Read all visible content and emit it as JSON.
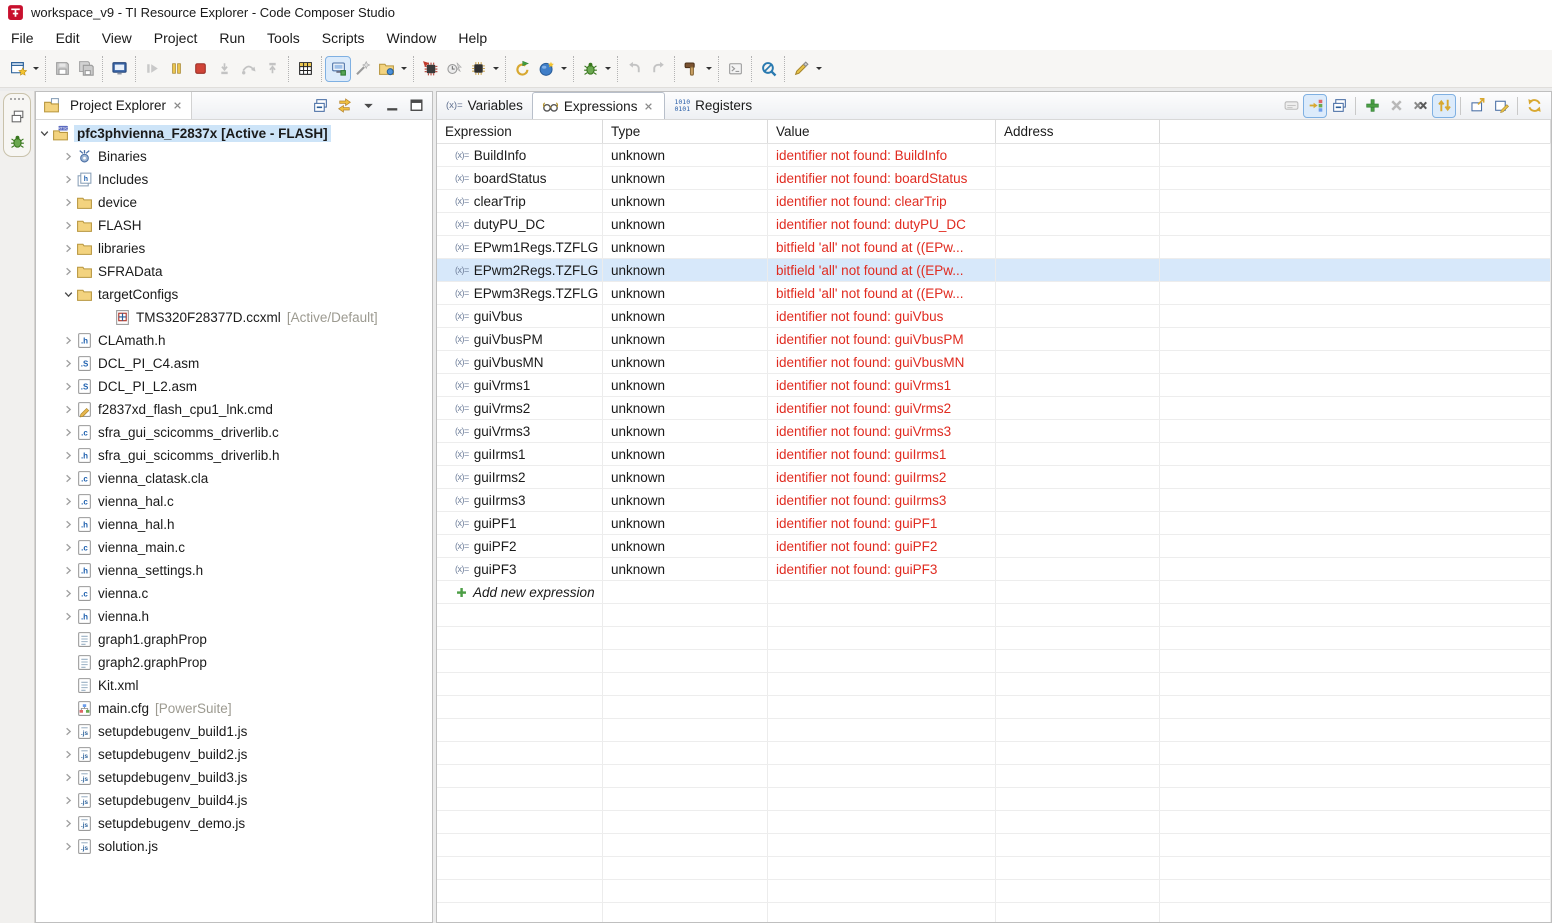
{
  "window": {
    "title": "workspace_v9 - TI Resource Explorer - Code Composer Studio"
  },
  "menu": {
    "items": [
      "File",
      "Edit",
      "View",
      "Project",
      "Run",
      "Tools",
      "Scripts",
      "Window",
      "Help"
    ]
  },
  "toolbar": {
    "groups": [
      {
        "items": [
          {
            "name": "new-wizard",
            "icon": "newwin",
            "dropdown": true
          }
        ]
      },
      {
        "items": [
          {
            "name": "save",
            "icon": "save"
          },
          {
            "name": "save-all",
            "icon": "saveall"
          }
        ]
      },
      {
        "items": [
          {
            "name": "debug-console",
            "icon": "consoleb"
          }
        ]
      },
      {
        "items": [
          {
            "name": "resume",
            "icon": "resume"
          },
          {
            "name": "suspend",
            "icon": "pause"
          },
          {
            "name": "terminate",
            "icon": "stop"
          },
          {
            "name": "step-into",
            "icon": "step1"
          },
          {
            "name": "step-over",
            "icon": "step2"
          },
          {
            "name": "step-return",
            "icon": "step3"
          }
        ]
      },
      {
        "items": [
          {
            "name": "view-registers",
            "icon": "grid"
          }
        ]
      },
      {
        "items": [
          {
            "name": "connect-target",
            "icon": "connect",
            "selected": true
          },
          {
            "name": "auto-connect",
            "icon": "wand"
          },
          {
            "name": "debug-project",
            "icon": "folderbug",
            "dropdown": true
          }
        ]
      },
      {
        "items": [
          {
            "name": "load-program",
            "icon": "loadchip"
          },
          {
            "name": "verify-flash",
            "icon": "flash"
          },
          {
            "name": "on-chip-flash",
            "icon": "chipdd",
            "dropdown": true
          }
        ]
      },
      {
        "items": [
          {
            "name": "restart",
            "icon": "restart"
          },
          {
            "name": "resource-explorer",
            "icon": "ball",
            "dropdown": true
          }
        ]
      },
      {
        "items": [
          {
            "name": "debug",
            "icon": "bug",
            "dropdown": true
          }
        ]
      },
      {
        "items": [
          {
            "name": "step-back",
            "icon": "hookl"
          },
          {
            "name": "step-forward",
            "icon": "hookr"
          }
        ]
      },
      {
        "items": [
          {
            "name": "build",
            "icon": "hammer",
            "dropdown": true
          }
        ]
      },
      {
        "items": [
          {
            "name": "open-console",
            "icon": "consolegray"
          }
        ]
      },
      {
        "items": [
          {
            "name": "search",
            "icon": "magnifier"
          }
        ]
      },
      {
        "items": [
          {
            "name": "flash-tool",
            "icon": "pen",
            "dropdown": true
          }
        ]
      }
    ]
  },
  "project_explorer": {
    "tab_label": "Project Explorer",
    "view_buttons": [
      {
        "name": "collapse-all",
        "icon": "collapseall"
      },
      {
        "name": "link-with-editor",
        "icon": "linked"
      },
      {
        "name": "view-menu",
        "icon": "vmenu"
      },
      {
        "name": "minimize",
        "icon": "vmin"
      },
      {
        "name": "maximize",
        "icon": "vmax"
      }
    ],
    "root": {
      "label": "pfc3phvienna_F2837x",
      "suffix": "[Active - FLASH]"
    },
    "items": [
      {
        "label": "Binaries",
        "icon": "bin",
        "chev": "collapsed",
        "level": 1
      },
      {
        "label": "Includes",
        "icon": "inc",
        "chev": "collapsed",
        "level": 1
      },
      {
        "label": "device",
        "icon": "folder",
        "chev": "collapsed",
        "level": 1
      },
      {
        "label": "FLASH",
        "icon": "folder",
        "chev": "collapsed",
        "level": 1
      },
      {
        "label": "libraries",
        "icon": "folder",
        "chev": "collapsed",
        "level": 1
      },
      {
        "label": "SFRAData",
        "icon": "folder",
        "chev": "collapsed",
        "level": 1
      },
      {
        "label": "targetConfigs",
        "icon": "folder",
        "chev": "expanded",
        "level": 1
      },
      {
        "label": "TMS320F28377D.ccxml",
        "suffix": "[Active/Default]",
        "icon": "ccxml",
        "chev": "none",
        "level": 2
      },
      {
        "label": "CLAmath.h",
        "icon": "h",
        "chev": "collapsed",
        "level": 1
      },
      {
        "label": "DCL_PI_C4.asm",
        "icon": "s",
        "chev": "collapsed",
        "level": 1
      },
      {
        "label": "DCL_PI_L2.asm",
        "icon": "s",
        "chev": "collapsed",
        "level": 1
      },
      {
        "label": "f2837xd_flash_cpu1_lnk.cmd",
        "icon": "cmd",
        "chev": "collapsed",
        "level": 1
      },
      {
        "label": "sfra_gui_scicomms_driverlib.c",
        "icon": "c",
        "chev": "collapsed",
        "level": 1
      },
      {
        "label": "sfra_gui_scicomms_driverlib.h",
        "icon": "h",
        "chev": "collapsed",
        "level": 1
      },
      {
        "label": "vienna_clatask.cla",
        "icon": "c",
        "chev": "collapsed",
        "level": 1
      },
      {
        "label": "vienna_hal.c",
        "icon": "c",
        "chev": "collapsed",
        "level": 1
      },
      {
        "label": "vienna_hal.h",
        "icon": "h",
        "chev": "collapsed",
        "level": 1
      },
      {
        "label": "vienna_main.c",
        "icon": "c",
        "chev": "collapsed",
        "level": 1
      },
      {
        "label": "vienna_settings.h",
        "icon": "h",
        "chev": "collapsed",
        "level": 1
      },
      {
        "label": "vienna.c",
        "icon": "c",
        "chev": "collapsed",
        "level": 1
      },
      {
        "label": "vienna.h",
        "icon": "h",
        "chev": "collapsed",
        "level": 1
      },
      {
        "label": "graph1.graphProp",
        "icon": "txt",
        "chev": "none",
        "level": 1
      },
      {
        "label": "graph2.graphProp",
        "icon": "txt",
        "chev": "none",
        "level": 1
      },
      {
        "label": "Kit.xml",
        "icon": "txt",
        "chev": "none",
        "level": 1
      },
      {
        "label": "main.cfg",
        "suffix": "[PowerSuite]",
        "icon": "cfg",
        "chev": "none",
        "level": 1
      },
      {
        "label": "setupdebugenv_build1.js",
        "icon": "js",
        "chev": "collapsed",
        "level": 1
      },
      {
        "label": "setupdebugenv_build2.js",
        "icon": "js",
        "chev": "collapsed",
        "level": 1
      },
      {
        "label": "setupdebugenv_build3.js",
        "icon": "js",
        "chev": "collapsed",
        "level": 1
      },
      {
        "label": "setupdebugenv_build4.js",
        "icon": "js",
        "chev": "collapsed",
        "level": 1
      },
      {
        "label": "setupdebugenv_demo.js",
        "icon": "js",
        "chev": "collapsed",
        "level": 1
      },
      {
        "label": "solution.js",
        "icon": "js",
        "chev": "collapsed",
        "level": 1
      }
    ]
  },
  "debug_view": {
    "tabs": [
      {
        "label": "Variables",
        "icon": "varicon",
        "active": false
      },
      {
        "label": "Expressions",
        "icon": "glasses",
        "active": true
      },
      {
        "label": "Registers",
        "icon": "regicon",
        "active": false
      }
    ],
    "view_buttons": [
      {
        "name": "show-type-names",
        "icon": "typenames"
      },
      {
        "name": "show-logical-structure",
        "icon": "logical",
        "selected": true
      },
      {
        "name": "collapse-all",
        "icon": "collapseall"
      },
      {
        "sep": true
      },
      {
        "name": "add-expression",
        "icon": "addplus"
      },
      {
        "name": "remove-expression",
        "icon": "grayx"
      },
      {
        "name": "remove-all-expressions",
        "icon": "darkxx"
      },
      {
        "name": "auto-refresh",
        "icon": "refreshud",
        "selected": true
      },
      {
        "sep": true
      },
      {
        "name": "detach-window",
        "icon": "detach"
      },
      {
        "name": "edit-watch-expression",
        "icon": "editv"
      },
      {
        "sep": true
      },
      {
        "name": "refresh",
        "icon": "refresh"
      }
    ],
    "columns": [
      "Expression",
      "Type",
      "Value",
      "Address"
    ],
    "selected_index": 5,
    "add_row_label": "Add new expression",
    "rows": [
      {
        "expression": "BuildInfo",
        "type": "unknown",
        "value": "identifier not found: BuildInfo",
        "address": ""
      },
      {
        "expression": "boardStatus",
        "type": "unknown",
        "value": "identifier not found: boardStatus",
        "address": ""
      },
      {
        "expression": "clearTrip",
        "type": "unknown",
        "value": "identifier not found: clearTrip",
        "address": ""
      },
      {
        "expression": "dutyPU_DC",
        "type": "unknown",
        "value": "identifier not found: dutyPU_DC",
        "address": ""
      },
      {
        "expression": "EPwm1Regs.TZFLG",
        "type": "unknown",
        "value": "bitfield 'all' not found at ((EPw...",
        "address": ""
      },
      {
        "expression": "EPwm2Regs.TZFLG",
        "type": "unknown",
        "value": "bitfield 'all' not found at ((EPw...",
        "address": ""
      },
      {
        "expression": "EPwm3Regs.TZFLG",
        "type": "unknown",
        "value": "bitfield 'all' not found at ((EPw...",
        "address": ""
      },
      {
        "expression": "guiVbus",
        "type": "unknown",
        "value": "identifier not found: guiVbus",
        "address": ""
      },
      {
        "expression": "guiVbusPM",
        "type": "unknown",
        "value": "identifier not found: guiVbusPM",
        "address": ""
      },
      {
        "expression": "guiVbusMN",
        "type": "unknown",
        "value": "identifier not found: guiVbusMN",
        "address": ""
      },
      {
        "expression": "guiVrms1",
        "type": "unknown",
        "value": "identifier not found: guiVrms1",
        "address": ""
      },
      {
        "expression": "guiVrms2",
        "type": "unknown",
        "value": "identifier not found: guiVrms2",
        "address": ""
      },
      {
        "expression": "guiVrms3",
        "type": "unknown",
        "value": "identifier not found: guiVrms3",
        "address": ""
      },
      {
        "expression": "guiIrms1",
        "type": "unknown",
        "value": "identifier not found: guiIrms1",
        "address": ""
      },
      {
        "expression": "guiIrms2",
        "type": "unknown",
        "value": "identifier not found: guiIrms2",
        "address": ""
      },
      {
        "expression": "guiIrms3",
        "type": "unknown",
        "value": "identifier not found: guiIrms3",
        "address": ""
      },
      {
        "expression": "guiPF1",
        "type": "unknown",
        "value": "identifier not found: guiPF1",
        "address": ""
      },
      {
        "expression": "guiPF2",
        "type": "unknown",
        "value": "identifier not found: guiPF2",
        "address": ""
      },
      {
        "expression": "guiPF3",
        "type": "unknown",
        "value": "identifier not found: guiPF3",
        "address": ""
      }
    ]
  },
  "colors": {
    "error_text": "#e02b20",
    "row_selection": "#d7e8fa",
    "tree_selection": "#cde4f8",
    "logo_red": "#c8102e"
  }
}
